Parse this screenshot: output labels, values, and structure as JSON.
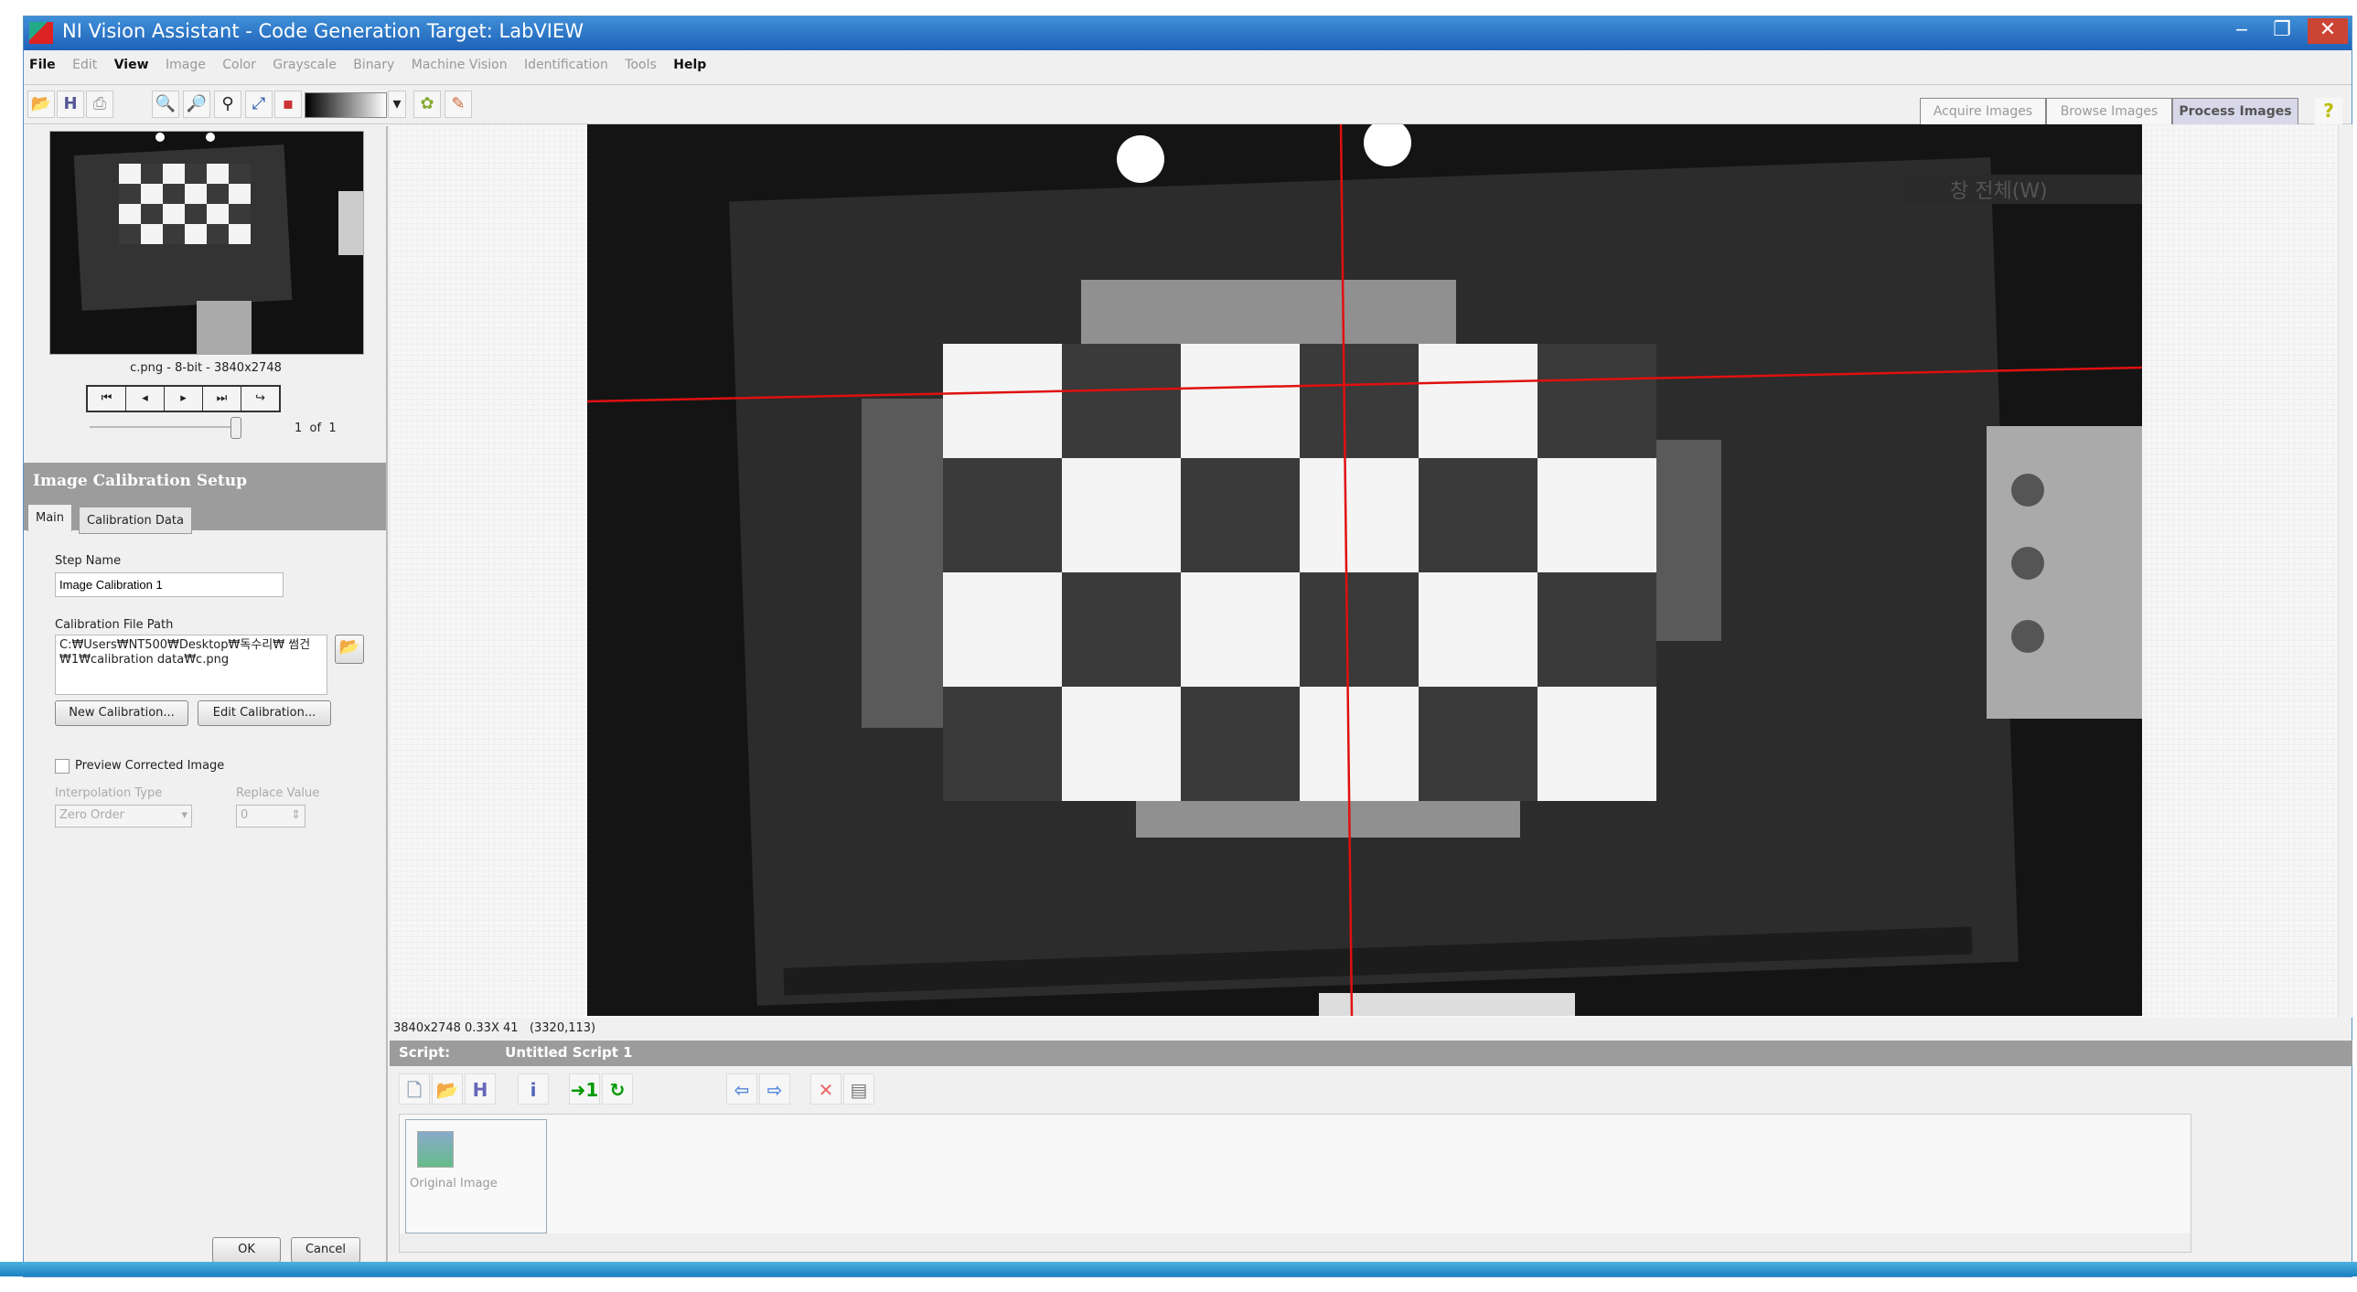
{
  "window": {
    "title": "NI Vision Assistant - Code Generation Target: LabVIEW",
    "minimize": "‒",
    "restore": "❐",
    "close": "✕"
  },
  "menu": [
    {
      "label": "File",
      "enabled": true
    },
    {
      "label": "Edit",
      "enabled": false
    },
    {
      "label": "View",
      "enabled": true
    },
    {
      "label": "Image",
      "enabled": false
    },
    {
      "label": "Color",
      "enabled": false
    },
    {
      "label": "Grayscale",
      "enabled": false
    },
    {
      "label": "Binary",
      "enabled": false
    },
    {
      "label": "Machine Vision",
      "enabled": false
    },
    {
      "label": "Identification",
      "enabled": false
    },
    {
      "label": "Tools",
      "enabled": false
    },
    {
      "label": "Help",
      "enabled": true
    }
  ],
  "modes": {
    "acquire": "Acquire Images",
    "browse": "Browse Images",
    "process": "Process Images",
    "help": "?"
  },
  "browser": {
    "info": "c.png - 8-bit - 3840x2748",
    "page": "1",
    "of": "of",
    "total": "1"
  },
  "calibration": {
    "title": "Image Calibration Setup",
    "tabs": [
      "Main",
      "Calibration Data"
    ],
    "step_name_label": "Step Name",
    "step_name": "Image Calibration 1",
    "path_label": "Calibration File Path",
    "path": "C:₩Users₩NT500₩Desktop₩독수리₩ 썸건₩1₩calibration data₩c.png",
    "new_btn": "New Calibration...",
    "edit_btn": "Edit Calibration...",
    "preview_label": "Preview Corrected Image",
    "interp_label": "Interpolation Type",
    "interp_value": "Zero Order",
    "replace_label": "Replace Value",
    "replace_value": "0",
    "ok": "OK",
    "cancel": "Cancel"
  },
  "viewer": {
    "status_size": "3840x2748 0.33X 41",
    "status_coord": "(3320,113)",
    "overlay_text": "창 전체(W)"
  },
  "script": {
    "label": "Script:",
    "name": "Untitled Script 1",
    "steps": [
      {
        "label": "Original Image"
      }
    ]
  },
  "colors": {
    "accent": "#1f62b8",
    "crosshair": "#e01010",
    "header": "#9c9c9c"
  }
}
